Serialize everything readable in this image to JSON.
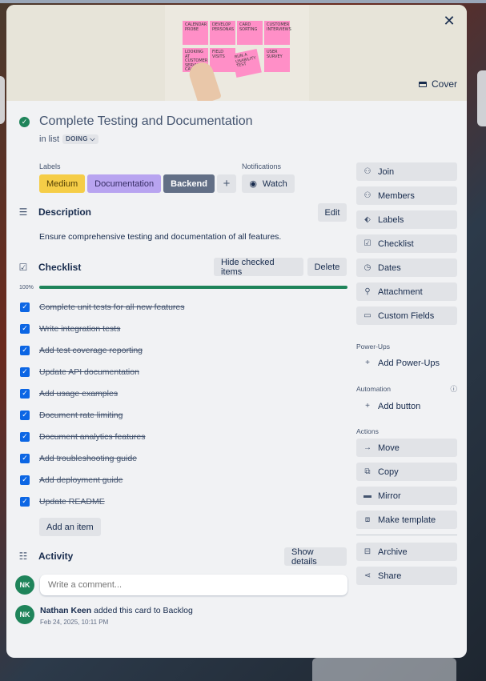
{
  "card": {
    "title": "Complete Testing and Documentation",
    "in_list_prefix": "in list",
    "list_name": "DOING",
    "cover_label": "Cover",
    "cover_stickies": [
      "CALENDAR PROBE",
      "DEVELOP PERSONAS",
      "CARD SORTING",
      "CUSTOMER INTERVIEWS",
      "LOOKING AT CUSTOMER SERVICE CALLS",
      "FIELD VISITS",
      "RUN A USABILITY TEST",
      "USER SURVEY"
    ]
  },
  "labels": {
    "heading": "Labels",
    "items": [
      {
        "name": "Medium",
        "color": "#f5cd47"
      },
      {
        "name": "Documentation",
        "color": "#b8a4f0"
      },
      {
        "name": "Backend",
        "color": "#626f86"
      }
    ],
    "add_symbol": "+"
  },
  "notifications": {
    "heading": "Notifications",
    "watch_label": "Watch"
  },
  "description": {
    "heading": "Description",
    "edit_label": "Edit",
    "text": "Ensure comprehensive testing and documentation of all features."
  },
  "checklist": {
    "heading": "Checklist",
    "hide_label": "Hide checked items",
    "delete_label": "Delete",
    "progress_text": "100%",
    "progress_value": 100,
    "items": [
      "Complete unit tests for all new features",
      "Write integration tests",
      "Add test coverage reporting",
      "Update API documentation",
      "Add usage examples",
      "Document rate limiting",
      "Document analytics features",
      "Add troubleshooting guide",
      "Add deployment guide",
      "Update README"
    ],
    "add_item_label": "Add an item"
  },
  "activity": {
    "heading": "Activity",
    "show_details_label": "Show details",
    "comment_placeholder": "Write a comment...",
    "avatar_initials": "NK",
    "entry_user": "Nathan Keen",
    "entry_action": " added this card to Backlog",
    "entry_time": "Feb 24, 2025, 10:11 PM"
  },
  "sidebar": {
    "primary": [
      "Join",
      "Members",
      "Labels",
      "Checklist",
      "Dates",
      "Attachment",
      "Custom Fields"
    ],
    "powerups_heading": "Power-Ups",
    "add_powerups": "Add Power-Ups",
    "automation_heading": "Automation",
    "add_button": "Add button",
    "actions_heading": "Actions",
    "actions": [
      "Move",
      "Copy",
      "Mirror",
      "Make template"
    ],
    "archive": "Archive",
    "share": "Share"
  },
  "colors": {
    "accent_blue": "#0c66e4",
    "success_green": "#1f845a",
    "modal_bg": "#f1f2f4"
  }
}
